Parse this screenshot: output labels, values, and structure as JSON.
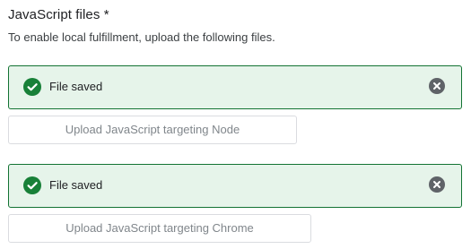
{
  "section": {
    "title": "JavaScript files *",
    "description": "To enable local fulfillment, upload the following files."
  },
  "uploads": [
    {
      "status_text": "File saved",
      "status_icon": "check-circle-icon",
      "dismiss_icon": "cancel-icon",
      "button_label": "Upload JavaScript targeting Node"
    },
    {
      "status_text": "File saved",
      "status_icon": "check-circle-icon",
      "dismiss_icon": "cancel-icon",
      "button_label": "Upload JavaScript targeting Chrome"
    }
  ],
  "colors": {
    "success_bg": "#e6f4ea",
    "success_border": "#137333",
    "success_icon": "#188038",
    "dismiss_icon": "#5f6368",
    "disabled_text": "#80868b"
  }
}
